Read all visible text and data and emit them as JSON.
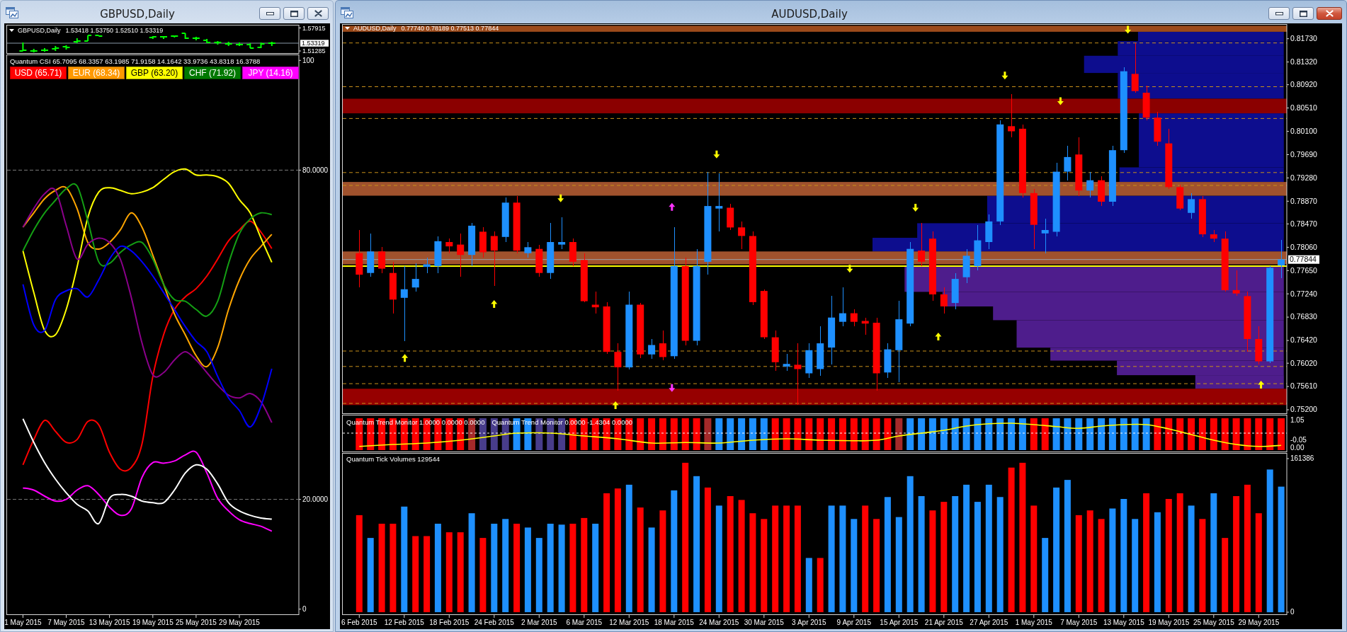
{
  "windows": [
    {
      "title": "GBPUSD,Daily",
      "active": false,
      "panes": [
        {
          "kind": "ohlc",
          "symbol": "GBPUSD,Daily",
          "quote": "1.53418 1.53750 1.52510 1.53319",
          "price_axis": [
            {
              "label": "1.57915",
              "current": false
            },
            {
              "label": "1.53319",
              "current": true
            },
            {
              "label": "1.51285",
              "current": false
            }
          ]
        },
        {
          "kind": "csi",
          "legend": [
            {
              "label": "USD (65.71)",
              "color": "#ff0000"
            },
            {
              "label": "EUR (68.34)",
              "color": "#ff9900"
            },
            {
              "label": "GBP (63.20)",
              "color": "#ffff00"
            },
            {
              "label": "CHF (71.92)",
              "color": "#007800"
            },
            {
              "label": "JPY (14.16)",
              "color": "#ff00ff"
            }
          ],
          "chart_data": {
            "type": "line",
            "title": "Quantum CSI 65.7095 68.3357 63.1985 71.9158 14.1642 33.9736 43.8318 16.3788",
            "categories": [
              null,
              "1 May 2015",
              null,
              null,
              null,
              "7 May 2015",
              null,
              null,
              null,
              "13 May 2015",
              null,
              null,
              null,
              "19 May 2015",
              null,
              null,
              null,
              "25 May 2015",
              null,
              null,
              null,
              "29 May 2015",
              null,
              null,
              null,
              null,
              null
            ],
            "ylim": [
              -1,
              101
            ],
            "yticks": [
              100,
              {
                "value": 80,
                "label": "80.0000"
              },
              {
                "value": 20,
                "label": "20.0000"
              },
              0
            ],
            "series": [
              {
                "color": "#ff0000",
                "values": [
                  null,
                  26.3,
                  30.9,
                  34.4,
                  32.4,
                  30.4,
                  30.9,
                  34.2,
                  33.6,
                  28.6,
                  25.5,
                  25.8,
                  30.1,
                  42.4,
                  50.0,
                  54.6,
                  56.9,
                  58.4,
                  60.7,
                  63.8,
                  67.1,
                  69.1,
                  70.7,
                  68.7,
                  65.7,
                  null,
                  null
                ]
              },
              {
                "color": "#ffa500",
                "values": [
                  null,
                  69.6,
                  72.2,
                  74.8,
                  76.3,
                  76.8,
                  73.0,
                  66.8,
                  65.6,
                  66.8,
                  69.1,
                  72.2,
                  69.6,
                  64.5,
                  59.2,
                  53.8,
                  50.0,
                  46.2,
                  44.2,
                  47.7,
                  54.6,
                  60.0,
                  63.8,
                  66.1,
                  68.3,
                  null,
                  null
                ]
              },
              {
                "color": "#ffff00",
                "values": [
                  null,
                  65.3,
                  57.7,
                  50.8,
                  50.0,
                  54.6,
                  62.3,
                  71.4,
                  76.0,
                  76.8,
                  76.3,
                  75.7,
                  76.0,
                  76.8,
                  78.3,
                  79.7,
                  80.2,
                  79.1,
                  79.1,
                  78.8,
                  77.6,
                  74.6,
                  72.2,
                  67.6,
                  63.2,
                  null,
                  null
                ]
              },
              {
                "color": "#14a014",
                "values": [
                  null,
                  65.3,
                  69.1,
                  72.2,
                  74.5,
                  76.6,
                  77.1,
                  70.7,
                  63.3,
                  63.0,
                  65.0,
                  66.4,
                  66.8,
                  63.8,
                  59.2,
                  56.4,
                  56.1,
                  54.6,
                  53.4,
                  56.1,
                  63.0,
                  68.4,
                  71.1,
                  72.2,
                  71.9,
                  null,
                  null
                ]
              },
              {
                "color": "#ff00ff",
                "values": [
                  null,
                  22.1,
                  21.7,
                  20.6,
                  19.7,
                  20.0,
                  21.7,
                  22.5,
                  20.9,
                  18.6,
                  17.1,
                  18.2,
                  24.0,
                  26.7,
                  26.6,
                  27.0,
                  28.1,
                  28.6,
                  24.8,
                  20.2,
                  17.9,
                  16.3,
                  15.6,
                  15.1,
                  14.2,
                  null,
                  null
                ]
              },
              {
                "color": "#8b008b",
                "values": [
                  null,
                  69.6,
                  73.0,
                  75.7,
                  76.3,
                  69.9,
                  63.8,
                  66.5,
                  67.6,
                  66.8,
                  63.8,
                  56.9,
                  48.5,
                  42.7,
                  43.1,
                  45.4,
                  46.9,
                  45.4,
                  43.1,
                  40.8,
                  39.0,
                  38.5,
                  39.3,
                  37.8,
                  34.0,
                  null,
                  null
                ]
              },
              {
                "color": "#0000ff",
                "values": [
                  null,
                  59.2,
                  51.8,
                  50.8,
                  56.4,
                  58.0,
                  58.4,
                  56.9,
                  60.0,
                  63.8,
                  66.1,
                  65.3,
                  63.3,
                  60.7,
                  57.7,
                  54.6,
                  51.5,
                  48.8,
                  46.9,
                  42.4,
                  38.5,
                  36.2,
                  33.2,
                  37.0,
                  43.8,
                  null,
                  null
                ]
              },
              {
                "color": "#ffffff",
                "values": [
                  null,
                  34.7,
                  30.4,
                  26.7,
                  23.7,
                  21.2,
                  19.1,
                  17.9,
                  15.6,
                  20.2,
                  20.9,
                  20.6,
                  19.7,
                  19.4,
                  19.4,
                  21.7,
                  24.8,
                  26.3,
                  25.5,
                  22.8,
                  19.4,
                  17.9,
                  17.1,
                  16.6,
                  16.4,
                  null,
                  null
                ]
              }
            ]
          }
        }
      ]
    },
    {
      "title": "AUDUSD,Daily",
      "active": true,
      "panes": [
        {
          "kind": "candles",
          "symbol": "AUDUSD,Daily",
          "quote": "0.77740 0.78189 0.77513 0.77844",
          "chart_data": {
            "type": "candlestick",
            "categories": [
              null,
              null,
              null,
              null,
              null,
              null,
              null,
              null,
              null,
              null,
              null,
              null,
              null,
              null,
              null,
              null,
              null,
              null,
              null,
              null,
              null,
              null,
              null,
              null,
              null,
              null,
              null,
              null,
              null,
              null,
              null,
              null,
              null,
              null,
              null,
              null,
              null,
              null,
              null,
              null,
              null,
              null,
              null,
              null,
              null,
              null,
              null,
              null,
              null,
              null,
              null,
              null,
              null,
              null,
              null,
              null,
              null,
              null,
              null,
              null,
              null,
              null,
              null,
              null,
              null,
              null,
              null,
              null,
              null,
              null,
              null,
              null,
              null,
              null,
              null,
              null,
              null,
              null,
              null,
              null,
              null,
              null,
              null,
              null
            ],
            "ylim": [
              0.75132,
              0.81981
            ],
            "yticks": [
              {
                "value": 0.8173,
                "label": "0.81730"
              },
              {
                "value": 0.8132,
                "label": "0.81320"
              },
              {
                "value": 0.8092,
                "label": "0.80920"
              },
              {
                "value": 0.8051,
                "label": "0.80510"
              },
              {
                "value": 0.801,
                "label": "0.80100"
              },
              {
                "value": 0.7969,
                "label": "0.79690"
              },
              {
                "value": 0.7928,
                "label": "0.79280"
              },
              {
                "value": 0.7887,
                "label": "0.78870"
              },
              {
                "value": 0.7847,
                "label": "0.78470"
              },
              {
                "value": 0.7806,
                "label": "0.78060"
              },
              {
                "value": 0.7765,
                "label": "0.77650"
              },
              {
                "value": 0.7724,
                "label": "0.77240"
              },
              {
                "value": 0.7683,
                "label": "0.76830"
              },
              {
                "value": 0.7642,
                "label": "0.76420"
              },
              {
                "value": 0.7602,
                "label": "0.76020"
              },
              {
                "value": 0.7561,
                "label": "0.75610"
              },
              {
                "value": 0.752,
                "label": "0.75200"
              }
            ],
            "bands": [
              {
                "axis": "y",
                "from": 0.81851,
                "to": 0.81957,
                "color": "#9c4a1a"
              },
              {
                "axis": "y",
                "from": 0.80417,
                "to": 0.80674,
                "color": "#8b0000"
              },
              {
                "axis": "y",
                "from": 0.78967,
                "to": 0.79209,
                "color": "#a0522d"
              },
              {
                "axis": "y",
                "from": 0.77759,
                "to": 0.77986,
                "color": "#a0522d"
              },
              {
                "axis": "y",
                "from": 0.75283,
                "to": 0.7557,
                "color": "#960000"
              }
            ],
            "ref_lines": [
              {
                "axis": "y",
                "value": 0.81655,
                "color": "#c8901a"
              },
              {
                "axis": "y",
                "value": 0.80885,
                "color": "#c8901a"
              },
              {
                "axis": "y",
                "value": 0.80326,
                "color": "#c8901a"
              },
              {
                "axis": "y",
                "value": 0.79375,
                "color": "#c8901a"
              },
              {
                "axis": "y",
                "value": 0.79148,
                "color": "#c8901a"
              },
              {
                "axis": "y",
                "value": 0.76234,
                "color": "#c8901a"
              },
              {
                "axis": "y",
                "value": 0.75962,
                "color": "#c8901a"
              },
              {
                "axis": "y",
                "value": 0.7566,
                "color": "#c8901a"
              },
              {
                "axis": "y",
                "value": 0.75313,
                "color": "#c8901a"
              },
              {
                "axis": "y",
                "value": 0.77729,
                "color": "#ffff00"
              },
              {
                "axis": "y",
                "value": 0.77844,
                "color": "#9aa4ad",
                "label": "0.77844"
              }
            ],
            "ohlc": [
              null,
              [
                0.77956,
                0.78363,
                0.77352,
                0.77578
              ],
              [
                0.77608,
                0.78303,
                0.77548,
                0.77986
              ],
              [
                0.77986,
                0.78061,
                0.77608,
                0.77684
              ],
              [
                0.77608,
                0.77805,
                0.76899,
                0.7714
              ],
              [
                0.7717,
                0.77729,
                0.76415,
                0.77321
              ],
              [
                0.77352,
                0.77774,
                0.77276,
                0.77503
              ],
              [
                0.77714,
                0.7788,
                0.77608,
                0.77759
              ],
              [
                0.77729,
                0.78258,
                0.77608,
                0.78167
              ],
              [
                0.78152,
                0.78212,
                0.77956,
                0.78076
              ],
              [
                0.78107,
                0.78303,
                0.77548,
                0.77925
              ],
              [
                0.77925,
                0.78484,
                0.77729,
                0.78439
              ],
              [
                0.78333,
                0.78409,
                0.7788,
                0.77971
              ],
              [
                0.78258,
                0.78333,
                0.77382,
                0.78001
              ],
              [
                0.78242,
                0.78937,
                0.78152,
                0.78846
              ],
              [
                0.78846,
                0.78967,
                0.77956,
                0.78001
              ],
              [
                0.77956,
                0.78152,
                0.7788,
                0.78061
              ],
              [
                0.78031,
                0.78107,
                0.77548,
                0.77608
              ],
              [
                0.77608,
                0.78484,
                0.77503,
                0.78152
              ],
              [
                0.78107,
                0.7859,
                0.78031,
                0.78152
              ],
              [
                0.78152,
                0.78212,
                0.77729,
                0.77805
              ],
              [
                0.77835,
                0.77956,
                0.77095,
                0.7711
              ],
              [
                0.7705,
                0.77276,
                0.76899,
                0.77004
              ],
              [
                0.77019,
                0.77095,
                0.76189,
                0.76219
              ],
              [
                0.76219,
                0.7637,
                0.7554,
                0.75947
              ],
              [
                0.75947,
                0.77276,
                0.75917,
                0.7705
              ],
              [
                0.7705,
                0.7708,
                0.76113,
                0.76174
              ],
              [
                0.76174,
                0.76446,
                0.76098,
                0.7634
              ],
              [
                0.7637,
                0.76597,
                0.76068,
                0.76128
              ],
              [
                0.76144,
                0.78409,
                0.76098,
                0.77729
              ],
              [
                0.77729,
                0.7788,
                0.7634,
                0.76415
              ],
              [
                0.76415,
                0.78031,
                0.7634,
                0.77729
              ],
              [
                0.77805,
                0.7939,
                0.77578,
                0.78786
              ],
              [
                0.78741,
                0.7936,
                0.78333,
                0.78786
              ],
              [
                0.78756,
                0.78831,
                0.78363,
                0.78409
              ],
              [
                0.78409,
                0.78514,
                0.78031,
                0.78258
              ],
              [
                0.78258,
                0.78333,
                0.7705,
                0.77095
              ],
              [
                0.77291,
                0.77321,
                0.76446,
                0.76476
              ],
              [
                0.76476,
                0.76597,
                0.75887,
                0.76038
              ],
              [
                0.75962,
                0.76189,
                0.75887,
                0.76008
              ],
              [
                0.75993,
                0.7637,
                0.75283,
                0.75917
              ],
              [
                0.75842,
                0.7637,
                0.75766,
                0.76249
              ],
              [
                0.75917,
                0.76672,
                0.75796,
                0.7637
              ],
              [
                0.76295,
                0.77201,
                0.75993,
                0.76823
              ],
              [
                0.76748,
                0.77352,
                0.76672,
                0.76899
              ],
              [
                0.76899,
                0.76974,
                0.76672,
                0.76748
              ],
              [
                0.76763,
                0.76823,
                0.76521,
                0.76717
              ],
              [
                0.76732,
                0.76823,
                0.7554,
                0.75842
              ],
              [
                0.75857,
                0.7637,
                0.75766,
                0.76264
              ],
              [
                0.76249,
                0.77125,
                0.75691,
                0.76793
              ],
              [
                0.76717,
                0.78152,
                0.76672,
                0.78031
              ],
              [
                0.78001,
                0.78484,
                0.77729,
                0.77805
              ],
              [
                0.78212,
                0.78333,
                0.77125,
                0.77231
              ],
              [
                0.77231,
                0.77352,
                0.76899,
                0.77019
              ],
              [
                0.7708,
                0.77608,
                0.76974,
                0.77503
              ],
              [
                0.77533,
                0.78031,
                0.77427,
                0.7791
              ],
              [
                0.77729,
                0.78454,
                0.77654,
                0.78182
              ],
              [
                0.78152,
                0.78635,
                0.78031,
                0.78514
              ],
              [
                0.78514,
                0.80296,
                0.78454,
                0.80221
              ],
              [
                0.8019,
                0.80749,
                0.79994,
                0.801
              ],
              [
                0.80145,
                0.80221,
                0.78937,
                0.79013
              ],
              [
                0.79013,
                0.79088,
                0.78031,
                0.78454
              ],
              [
                0.78303,
                0.7856,
                0.77956,
                0.78363
              ],
              [
                0.78333,
                0.79541,
                0.78258,
                0.7939
              ],
              [
                0.7939,
                0.79843,
                0.79239,
                0.79647
              ],
              [
                0.79692,
                0.79994,
                0.78967,
                0.79058
              ],
              [
                0.79058,
                0.7939,
                0.78937,
                0.79239
              ],
              [
                0.79239,
                0.79315,
                0.78786,
                0.78862
              ],
              [
                0.78862,
                0.79843,
                0.78786,
                0.79768
              ],
              [
                0.79768,
                0.81232,
                0.79722,
                0.81157
              ],
              [
                0.81111,
                0.81655,
                0.80779,
                0.80809
              ],
              [
                0.80779,
                0.809,
                0.80296,
                0.80341
              ],
              [
                0.80341,
                0.80447,
                0.79843,
                0.79918
              ],
              [
                0.79888,
                0.80145,
                0.79088,
                0.79118
              ],
              [
                0.79118,
                0.79164,
                0.78711,
                0.78741
              ],
              [
                0.78665,
                0.79013,
                0.7856,
                0.78907
              ],
              [
                0.78907,
                0.78967,
                0.78242,
                0.78288
              ],
              [
                0.78288,
                0.78363,
                0.78152,
                0.78212
              ],
              [
                0.78212,
                0.78333,
                0.77276,
                0.77306
              ],
              [
                0.77306,
                0.77654,
                0.77201,
                0.77246
              ],
              [
                0.77201,
                0.77276,
                0.76219,
                0.76446
              ],
              [
                0.76446,
                0.76672,
                0.75993,
                0.76053
              ],
              [
                0.76053,
                0.77729,
                0.76023,
                0.77699
              ],
              [
                0.7774,
                0.78189,
                0.77513,
                0.77844
              ]
            ]
          }
        },
        {
          "kind": "trend",
          "headers": [
            "Quantum Trend Monitor 1.0000 0.0000 0.0000",
            "Quantum Trend Monitor 0.0000 -1.4304 0.0000"
          ],
          "axis_labels": [
            "1.05",
            "-0.05",
            "0.00"
          ],
          "bars": [
            {
              "color": "#ff0000"
            },
            {
              "color": "#ff0000"
            },
            {
              "color": "#ff0000"
            },
            {
              "color": "#ff0000"
            },
            {
              "color": "#ff0000"
            },
            {
              "color": "#ff0000"
            },
            {
              "color": "#ff0000"
            },
            {
              "color": "#ff0000"
            },
            {
              "color": "#ff0000"
            },
            {
              "color": "#ff0000"
            },
            {
              "color": "#a52a2a"
            },
            {
              "color": "#483d8b"
            },
            {
              "color": "#483d8b"
            },
            {
              "color": "#483d8b"
            },
            {
              "color": "#1e90ff"
            },
            {
              "color": "#1e90ff"
            },
            {
              "color": "#483d8b"
            },
            {
              "color": "#483d8b"
            },
            {
              "color": "#483d8b"
            },
            {
              "color": "#ff0000"
            },
            {
              "color": "#ff0000"
            },
            {
              "color": "#ff0000"
            },
            {
              "color": "#ff0000"
            },
            {
              "color": "#ff0000"
            },
            {
              "color": "#ff0000"
            },
            {
              "color": "#ff0000"
            },
            {
              "color": "#ff0000"
            },
            {
              "color": "#ff0000"
            },
            {
              "color": "#ff0000"
            },
            {
              "color": "#ff0000"
            },
            {
              "color": "#ff0000"
            },
            {
              "color": "#a52a2a"
            },
            {
              "color": "#1e90ff"
            },
            {
              "color": "#1e90ff"
            },
            {
              "color": "#1e90ff"
            },
            {
              "color": "#1e90ff"
            },
            {
              "color": "#1e90ff"
            },
            {
              "color": "#ff0000"
            },
            {
              "color": "#ff0000"
            },
            {
              "color": "#ff0000"
            },
            {
              "color": "#ff0000"
            },
            {
              "color": "#ff0000"
            },
            {
              "color": "#ff0000"
            },
            {
              "color": "#ff0000"
            },
            {
              "color": "#ff0000"
            },
            {
              "color": "#ff0000"
            },
            {
              "color": "#ff0000"
            },
            {
              "color": "#ff0000"
            },
            {
              "color": "#a52a2a"
            },
            {
              "color": "#1e90ff"
            },
            {
              "color": "#1e90ff"
            },
            {
              "color": "#1e90ff"
            },
            {
              "color": "#1e90ff"
            },
            {
              "color": "#1e90ff"
            },
            {
              "color": "#1e90ff"
            },
            {
              "color": "#1e90ff"
            },
            {
              "color": "#1e90ff"
            },
            {
              "color": "#1e90ff"
            },
            {
              "color": "#1e90ff"
            },
            {
              "color": "#1e90ff"
            },
            {
              "color": "#ff0000"
            },
            {
              "color": "#ff0000"
            },
            {
              "color": "#1e90ff"
            },
            {
              "color": "#1e90ff"
            },
            {
              "color": "#1e90ff"
            },
            {
              "color": "#1e90ff"
            },
            {
              "color": "#1e90ff"
            },
            {
              "color": "#1e90ff"
            },
            {
              "color": "#1e90ff"
            },
            {
              "color": "#1e90ff"
            },
            {
              "color": "#1e90ff"
            },
            {
              "color": "#ff0000"
            },
            {
              "color": "#ff0000"
            },
            {
              "color": "#ff0000"
            },
            {
              "color": "#ff0000"
            },
            {
              "color": "#ff0000"
            },
            {
              "color": "#ff0000"
            },
            {
              "color": "#ff0000"
            },
            {
              "color": "#ff0000"
            },
            {
              "color": "#ff0000"
            },
            {
              "color": "#ff0000"
            },
            {
              "color": "#ff0000"
            },
            {
              "color": "#ff0000"
            }
          ]
        },
        {
          "kind": "volume",
          "chart_data": {
            "type": "bar",
            "title": "Quantum Tick Volumes 129544",
            "categories": [
              null,
              "6 Feb 2015",
              null,
              null,
              null,
              "12 Feb 2015",
              null,
              null,
              null,
              "18 Feb 2015",
              null,
              null,
              null,
              "24 Feb 2015",
              null,
              null,
              null,
              "2 Mar 2015",
              null,
              null,
              null,
              "6 Mar 2015",
              null,
              null,
              null,
              "12 Mar 2015",
              null,
              null,
              null,
              "18 Mar 2015",
              null,
              null,
              null,
              "24 Mar 2015",
              null,
              null,
              null,
              "30 Mar 2015",
              null,
              null,
              null,
              "3 Apr 2015",
              null,
              null,
              null,
              "9 Apr 2015",
              null,
              null,
              null,
              "15 Apr 2015",
              null,
              null,
              null,
              "21 Apr 2015",
              null,
              null,
              null,
              "27 Apr 2015",
              null,
              null,
              null,
              "1 May 2015",
              null,
              null,
              null,
              "7 May 2015",
              null,
              null,
              null,
              "13 May 2015",
              null,
              null,
              null,
              "19 May 2015",
              null,
              null,
              null,
              "25 May 2015",
              null,
              null,
              null,
              "29 May 2015",
              null,
              null
            ],
            "ylim": [
              -2600,
              167000
            ],
            "yticks": [
              161386,
              0
            ],
            "series": [
              {
                "color": "#1e90ff",
                "values": [
                  null,
                  null,
                  78000,
                  null,
                  null,
                  111000,
                  null,
                  null,
                  93000,
                  null,
                  null,
                  104000,
                  null,
                  93000,
                  98000,
                  null,
                  89000,
                  78000,
                  93000,
                  92000,
                  null,
                  null,
                  93000,
                  null,
                  null,
                  134000,
                  null,
                  89000,
                  null,
                  128000,
                  null,
                  143000,
                  null,
                  112000,
                  null,
                  null,
                  null,
                  null,
                  null,
                  null,
                  null,
                  57000,
                  null,
                  112000,
                  112000,
                  98000,
                  null,
                  null,
                  121000,
                  100000,
                  143000,
                  122000,
                  null,
                  null,
                  122000,
                  134000,
                  116000,
                  134000,
                  121000,
                  null,
                  null,
                  null,
                  78000,
                  131000,
                  139000,
                  null,
                  null,
                  null,
                  109000,
                  119000,
                  98000,
                  null,
                  105000,
                  null,
                  null,
                  112000,
                  null,
                  125000,
                  null,
                  null,
                  null,
                  null,
                  150000,
                  132000
                ]
              },
              {
                "color": "#ff0000",
                "values": [
                  null,
                  102000,
                  null,
                  93000,
                  93000,
                  null,
                  80000,
                  80000,
                  null,
                  84000,
                  84000,
                  null,
                  78000,
                  null,
                  null,
                  93000,
                  null,
                  null,
                  null,
                  null,
                  93000,
                  99000,
                  null,
                  125000,
                  130000,
                  null,
                  110000,
                  null,
                  107000,
                  null,
                  157000,
                  null,
                  131000,
                  null,
                  122000,
                  118000,
                  104000,
                  98000,
                  112000,
                  112000,
                  112000,
                  null,
                  57000,
                  null,
                  null,
                  null,
                  112000,
                  98000,
                  null,
                  null,
                  null,
                  null,
                  107000,
                  116000,
                  null,
                  null,
                  null,
                  null,
                  null,
                  152000,
                  157000,
                  112000,
                  null,
                  null,
                  null,
                  102000,
                  107000,
                  98000,
                  null,
                  null,
                  null,
                  125000,
                  null,
                  119000,
                  125000,
                  null,
                  98000,
                  null,
                  78000,
                  122000,
                  134000,
                  104000,
                  null,
                  null
                ]
              }
            ]
          }
        }
      ]
    }
  ]
}
